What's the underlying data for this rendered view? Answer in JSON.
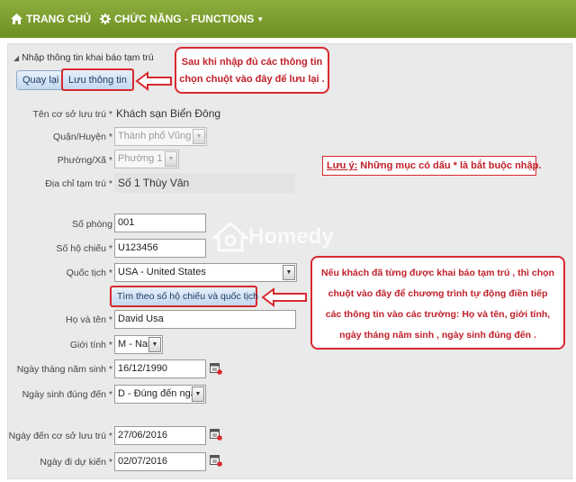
{
  "topbar": {
    "home_label": "TRANG CHỦ",
    "functions_label": "CHỨC NĂNG - FUNCTIONS"
  },
  "section": {
    "title": "Nhập thông tin khai báo tạm trú"
  },
  "buttons": {
    "back": "Quay lại",
    "save": "Lưu thông tin",
    "search_passport": "Tìm theo số hộ chiếu và quốc tịch"
  },
  "callouts": {
    "save_hint_line1": "Sau khi nhập đủ các thông tin",
    "save_hint_line2": "chọn chuột vào đây để lưu lại .",
    "search_hint_line1": "Nếu khách đã từng được khai báo tạm trú , thì chọn",
    "search_hint_line2": "chuột vào đây để chương trình tự động điền tiếp",
    "search_hint_line3": "các thông tin vào các trường: Họ và tên, giới tính,",
    "search_hint_line4": "ngày tháng năm sinh , ngày sinh đúng đến ."
  },
  "note": {
    "prefix": "Lưu ý:",
    "text": " Những mục có dấu * là bắt buộc nhập."
  },
  "watermark": "Homedy",
  "fields": {
    "facility": {
      "label": "Tên cơ sở lưu trú *",
      "value": "Khách sạn Biển Đông"
    },
    "district": {
      "label": "Quận/Huyện *",
      "value": "Thành phố Vũng Tàu"
    },
    "ward": {
      "label": "Phường/Xã *",
      "value": "Phường 1"
    },
    "address": {
      "label": "Địa chỉ tạm trú *",
      "value": "Số 1 Thùy Vân"
    },
    "room": {
      "label": "Số phòng",
      "value": "001"
    },
    "passport": {
      "label": "Số hộ chiếu *",
      "value": "U123456"
    },
    "nationality": {
      "label": "Quốc tịch *",
      "value": "USA - United States"
    },
    "fullname": {
      "label": "Họ và tên *",
      "value": "David Usa"
    },
    "gender": {
      "label": "Giới tính *",
      "value": "M - Nam"
    },
    "dob": {
      "label": "Ngày tháng năm sinh *",
      "value": "16/12/1990"
    },
    "dob_precision": {
      "label": "Ngày sinh đúng đến *",
      "value": "D - Đúng đến ngày"
    },
    "arrival": {
      "label": "Ngày đến cơ sở lưu trú *",
      "value": "27/06/2016"
    },
    "departure": {
      "label": "Ngày đi dự kiến *",
      "value": "02/07/2016"
    }
  },
  "colors": {
    "topbar": "#7a9c2e",
    "highlight": "#d9282f",
    "panel": "#eaeaea"
  }
}
